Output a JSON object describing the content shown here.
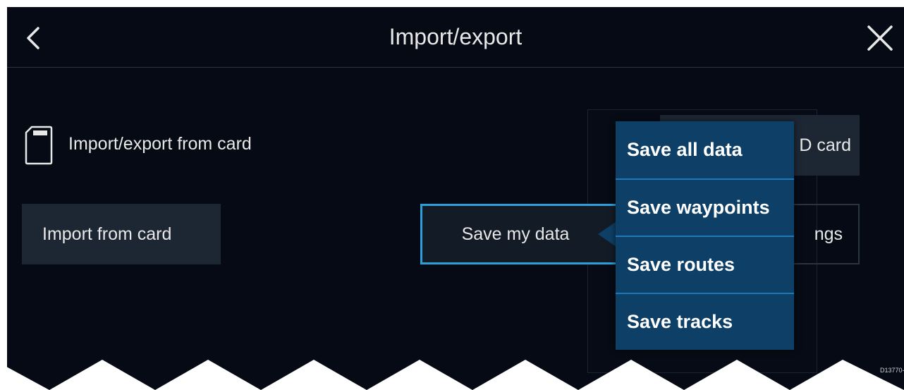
{
  "header": {
    "title": "Import/export"
  },
  "card_section": {
    "label": "Import/export from card",
    "icon": "sd-card-icon"
  },
  "buttons": {
    "import_from_card": "Import from card",
    "save_my_data": "Save my data",
    "sd_card_partial": "D card",
    "settings_partial": "ngs"
  },
  "popup_menu": {
    "items": [
      {
        "label": "Save all data"
      },
      {
        "label": "Save waypoints"
      },
      {
        "label": "Save routes"
      },
      {
        "label": "Save tracks"
      }
    ]
  },
  "colors": {
    "background": "#050a14",
    "button": "#1d2733",
    "focus_border": "#2b9fd9",
    "popup": "#0e3f66",
    "popup_divider": "#1f78b8"
  },
  "figure_code": "D13770-"
}
